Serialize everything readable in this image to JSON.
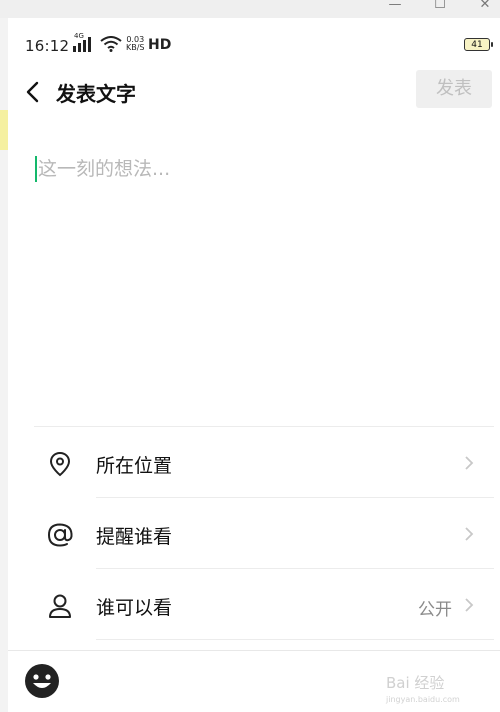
{
  "window": {
    "minimize_glyph": "—",
    "maximize_glyph": "☐",
    "close_glyph": "✕"
  },
  "status_bar": {
    "time": "16:12",
    "network": "4G",
    "speed_value": "0.03",
    "speed_unit": "KB/S",
    "hd": "HD",
    "battery": "41"
  },
  "header": {
    "back_icon": "chevron-left-icon",
    "title": "发表文字",
    "publish_label": "发表"
  },
  "composer": {
    "placeholder": "这一刻的想法...",
    "value": ""
  },
  "options": [
    {
      "icon": "location-pin-icon",
      "label": "所在位置",
      "value": ""
    },
    {
      "icon": "at-sign-icon",
      "label": "提醒谁看",
      "value": ""
    },
    {
      "icon": "person-icon",
      "label": "谁可以看",
      "value": "公开"
    }
  ],
  "toolbar": {
    "emoji_icon": "emoji-icon"
  },
  "watermark": {
    "text": "Bai 经验",
    "sub": "jingyan.baidu.com"
  },
  "colors": {
    "caret": "#14b86b",
    "publish_bg": "#efefef",
    "publish_text": "#c0c0c0"
  }
}
